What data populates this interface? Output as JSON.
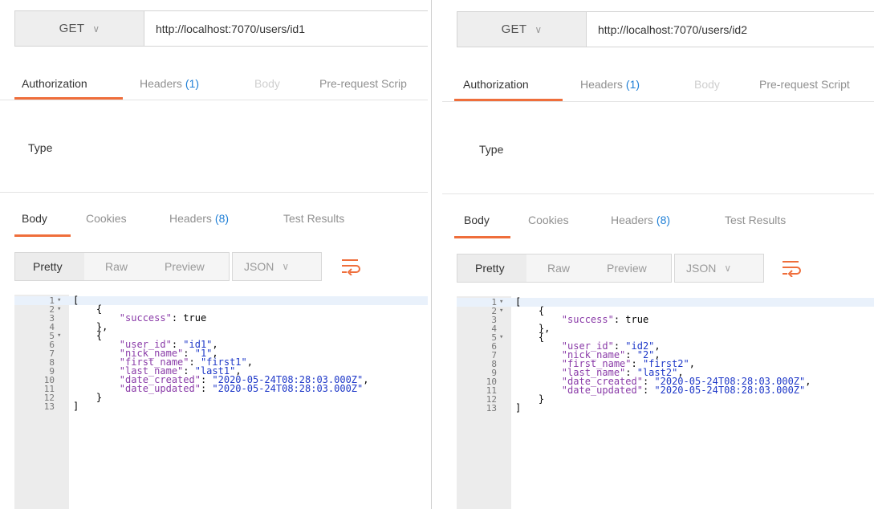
{
  "request_panels": [
    {
      "method": "GET",
      "url": "http://localhost:7070/users/id1",
      "request_tabs": [
        {
          "label": "Authorization"
        },
        {
          "label": "Headers",
          "count": "(1)"
        },
        {
          "label": "Body"
        },
        {
          "label": "Pre-request Scrip"
        }
      ],
      "type_label": "Type",
      "response_tabs": [
        {
          "label": "Body"
        },
        {
          "label": "Cookies"
        },
        {
          "label": "Headers",
          "count": "(8)"
        },
        {
          "label": "Test Results"
        }
      ],
      "format_buttons": [
        "Pretty",
        "Raw",
        "Preview"
      ],
      "language": "JSON",
      "code_lines": [
        {
          "n": "1",
          "fold": "▾",
          "text": "["
        },
        {
          "n": "2",
          "fold": "▾",
          "text": "    {"
        },
        {
          "n": "3",
          "fold": "",
          "key": "\"success\"",
          "sep": ": ",
          "bool": "true",
          "indent": "        "
        },
        {
          "n": "4",
          "fold": "",
          "text": "    },"
        },
        {
          "n": "5",
          "fold": "▾",
          "text": "    {"
        },
        {
          "n": "6",
          "fold": "",
          "key": "\"user_id\"",
          "sep": ": ",
          "str": "\"id1\"",
          "tail": ",",
          "indent": "        "
        },
        {
          "n": "7",
          "fold": "",
          "key": "\"nick_name\"",
          "sep": ": ",
          "str": "\"1\"",
          "tail": ",",
          "indent": "        "
        },
        {
          "n": "8",
          "fold": "",
          "key": "\"first_name\"",
          "sep": ": ",
          "str": "\"first1\"",
          "tail": ",",
          "indent": "        "
        },
        {
          "n": "9",
          "fold": "",
          "key": "\"last_name\"",
          "sep": ": ",
          "str": "\"last1\"",
          "tail": ",",
          "indent": "        "
        },
        {
          "n": "10",
          "fold": "",
          "key": "\"date_created\"",
          "sep": ": ",
          "str": "\"2020-05-24T08:28:03.000Z\"",
          "tail": ",",
          "indent": "        "
        },
        {
          "n": "11",
          "fold": "",
          "key": "\"date_updated\"",
          "sep": ": ",
          "str": "\"2020-05-24T08:28:03.000Z\"",
          "tail": "",
          "indent": "        "
        },
        {
          "n": "12",
          "fold": "",
          "text": "    }"
        },
        {
          "n": "13",
          "fold": "",
          "text": "]"
        }
      ]
    },
    {
      "method": "GET",
      "url": "http://localhost:7070/users/id2",
      "request_tabs": [
        {
          "label": "Authorization"
        },
        {
          "label": "Headers",
          "count": "(1)"
        },
        {
          "label": "Body"
        },
        {
          "label": "Pre-request Script"
        }
      ],
      "type_label": "Type",
      "response_tabs": [
        {
          "label": "Body"
        },
        {
          "label": "Cookies"
        },
        {
          "label": "Headers",
          "count": "(8)"
        },
        {
          "label": "Test Results"
        }
      ],
      "format_buttons": [
        "Pretty",
        "Raw",
        "Preview"
      ],
      "language": "JSON",
      "code_lines": [
        {
          "n": "1",
          "fold": "▾",
          "text": "["
        },
        {
          "n": "2",
          "fold": "▾",
          "text": "    {"
        },
        {
          "n": "3",
          "fold": "",
          "key": "\"success\"",
          "sep": ": ",
          "bool": "true",
          "indent": "        "
        },
        {
          "n": "4",
          "fold": "",
          "text": "    },"
        },
        {
          "n": "5",
          "fold": "▾",
          "text": "    {"
        },
        {
          "n": "6",
          "fold": "",
          "key": "\"user_id\"",
          "sep": ": ",
          "str": "\"id2\"",
          "tail": ",",
          "indent": "        "
        },
        {
          "n": "7",
          "fold": "",
          "key": "\"nick_name\"",
          "sep": ": ",
          "str": "\"2\"",
          "tail": ",",
          "indent": "        "
        },
        {
          "n": "8",
          "fold": "",
          "key": "\"first_name\"",
          "sep": ": ",
          "str": "\"first2\"",
          "tail": ",",
          "indent": "        "
        },
        {
          "n": "9",
          "fold": "",
          "key": "\"last_name\"",
          "sep": ": ",
          "str": "\"last2\"",
          "tail": ",",
          "indent": "        "
        },
        {
          "n": "10",
          "fold": "",
          "key": "\"date_created\"",
          "sep": ": ",
          "str": "\"2020-05-24T08:28:03.000Z\"",
          "tail": ",",
          "indent": "        "
        },
        {
          "n": "11",
          "fold": "",
          "key": "\"date_updated\"",
          "sep": ": ",
          "str": "\"2020-05-24T08:28:03.000Z\"",
          "tail": "",
          "indent": "        "
        },
        {
          "n": "12",
          "fold": "",
          "text": "    }"
        },
        {
          "n": "13",
          "fold": "",
          "text": "]"
        }
      ]
    }
  ],
  "icons": {
    "chevron": "chevron-down-icon",
    "wrap": "wrap-lines-icon"
  },
  "colors": {
    "accent": "#ef6e3b",
    "count": "#1f7fd6",
    "json_key": "#8a3ba8",
    "json_string": "#1e38c8"
  }
}
